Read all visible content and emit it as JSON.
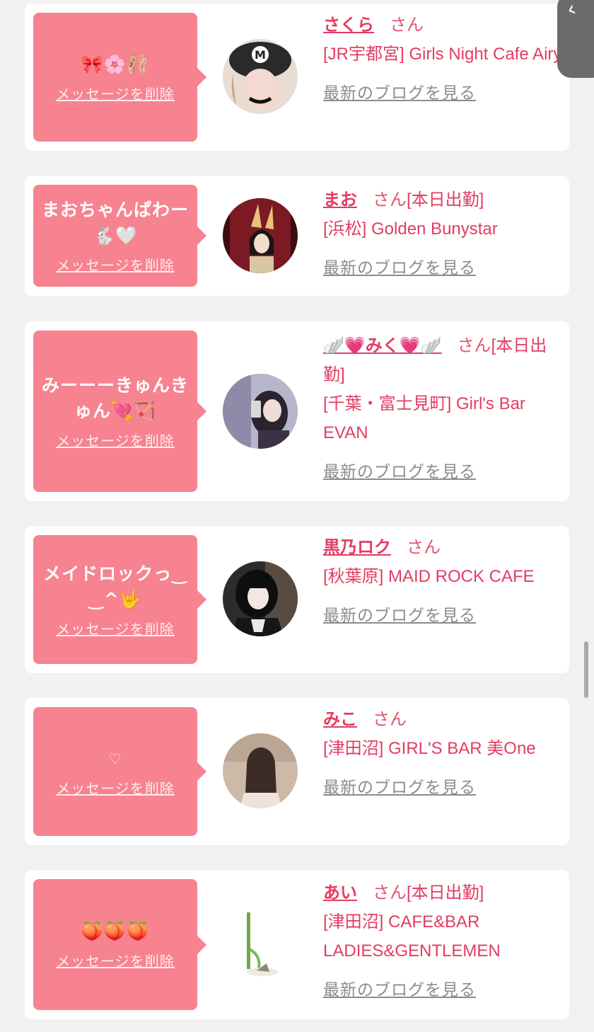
{
  "colors": {
    "page_background": "#f1f1f1",
    "bubble": "#f6838f",
    "accent_text": "#e33c62",
    "muted_link": "#8c8c8c"
  },
  "labels": {
    "delete_message": "メッセージを削除",
    "view_blog": "最新のブログを見る",
    "honorific": "さん"
  },
  "entries": [
    {
      "message": "🎀🌸🩰",
      "name": "さくら",
      "status": "",
      "shop": "[JR宇都宮] Girls Night Cafe Airy",
      "avatar": "character-cap-photo"
    },
    {
      "message": "まおちゃんぱわー🐇🤍",
      "name": "まお",
      "status": "[本日出勤]",
      "shop": "[浜松] Golden Bunystar",
      "avatar": "bunny-ears-photo"
    },
    {
      "message": "みーーーきゅんきゅん💘🏹",
      "name": "🪽💗みく💗🪽",
      "status": "[本日出勤]",
      "shop": "[千葉・富士見町] Girl's Bar EVAN",
      "avatar": "mirror-selfie-photo"
    },
    {
      "message": "メイドロックっ‿ ‿^🤟",
      "name": "黒乃ロク",
      "status": "",
      "shop": "[秋葉原] MAID ROCK CAFE",
      "avatar": "black-hair-photo"
    },
    {
      "message": "♡",
      "name": "みこ",
      "status": "",
      "shop": "[津田沼] GIRL'S BAR 美One",
      "avatar": "back-view-photo"
    },
    {
      "message": "🍑🍑🍑",
      "name": "あい",
      "status": "[本日出勤]",
      "shop": "[津田沼] CAFE&BAR LADIES&GENTLEMEN",
      "avatar": "plant-illustration"
    }
  ]
}
